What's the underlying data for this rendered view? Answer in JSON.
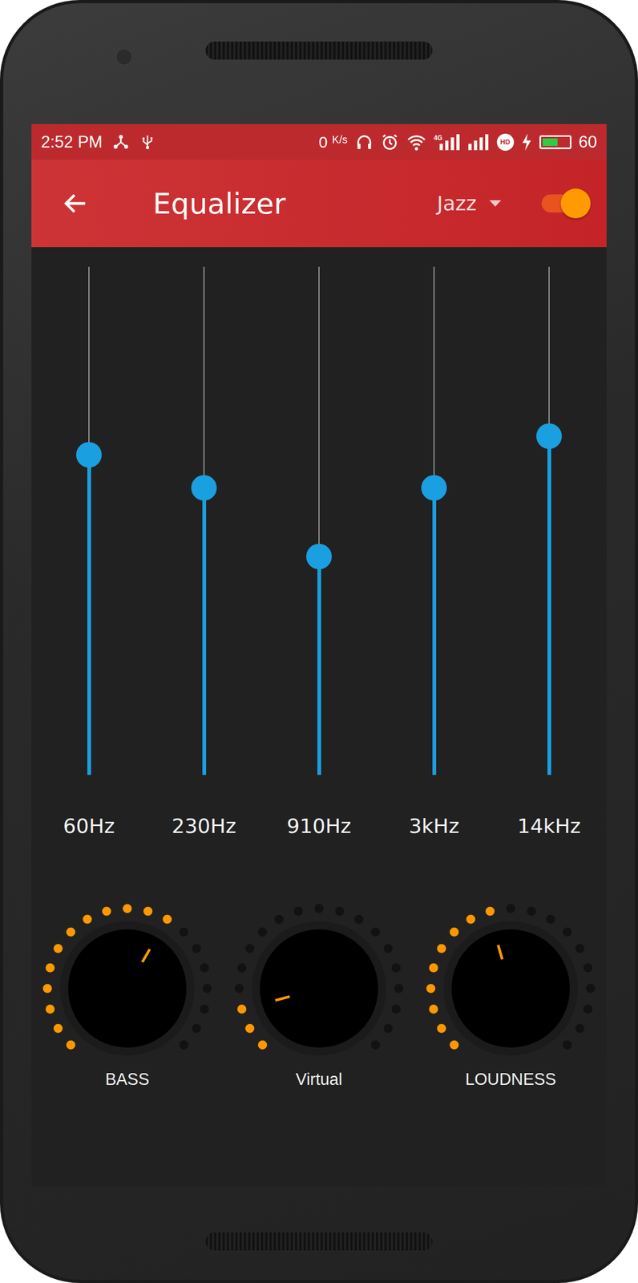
{
  "status_bar": {
    "time": "2:52 PM",
    "speed": "0",
    "speed_unit": "K/s",
    "network": "4G",
    "hd": "HD",
    "battery": "60",
    "battery_level": 0.6,
    "charging": true
  },
  "toolbar": {
    "title": "Equalizer",
    "preset": "Jazz",
    "enabled": true
  },
  "bands": [
    {
      "label": "60Hz",
      "level": 0.63
    },
    {
      "label": "230Hz",
      "level": 0.565
    },
    {
      "label": "910Hz",
      "level": 0.43
    },
    {
      "label": "3kHz",
      "level": 0.565
    },
    {
      "label": "14kHz",
      "level": 0.667
    }
  ],
  "knobs": [
    {
      "label": "BASS",
      "level": 0.61
    },
    {
      "label": "Virtual",
      "level": 0.11
    },
    {
      "label": "LOUDNESS",
      "level": 0.44
    }
  ]
}
